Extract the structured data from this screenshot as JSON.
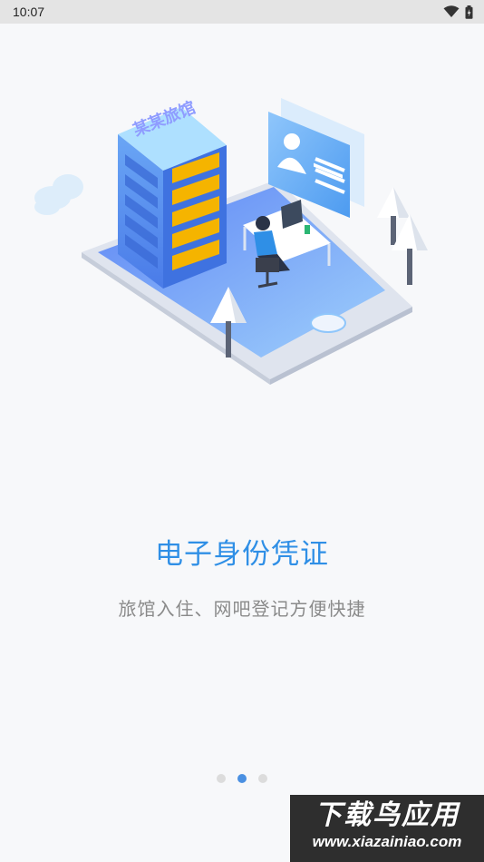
{
  "status_bar": {
    "time": "10:07",
    "icons": [
      "wifi-icon",
      "battery-icon"
    ]
  },
  "illustration": {
    "building_sign": "某某旅馆"
  },
  "onboarding": {
    "title": "电子身份凭证",
    "subtitle": "旅馆入住、网吧登记方便快捷",
    "page_indicator": {
      "total": 3,
      "current": 2
    }
  },
  "watermark": {
    "title": "下载鸟应用",
    "url": "www.xiazainiao.com"
  },
  "colors": {
    "title": "#2f8fe6",
    "subtitle": "#8a8a8a",
    "dot_active": "#4a90e2",
    "dot_inactive": "#dcdcdc",
    "background": "#f7f8fa"
  }
}
